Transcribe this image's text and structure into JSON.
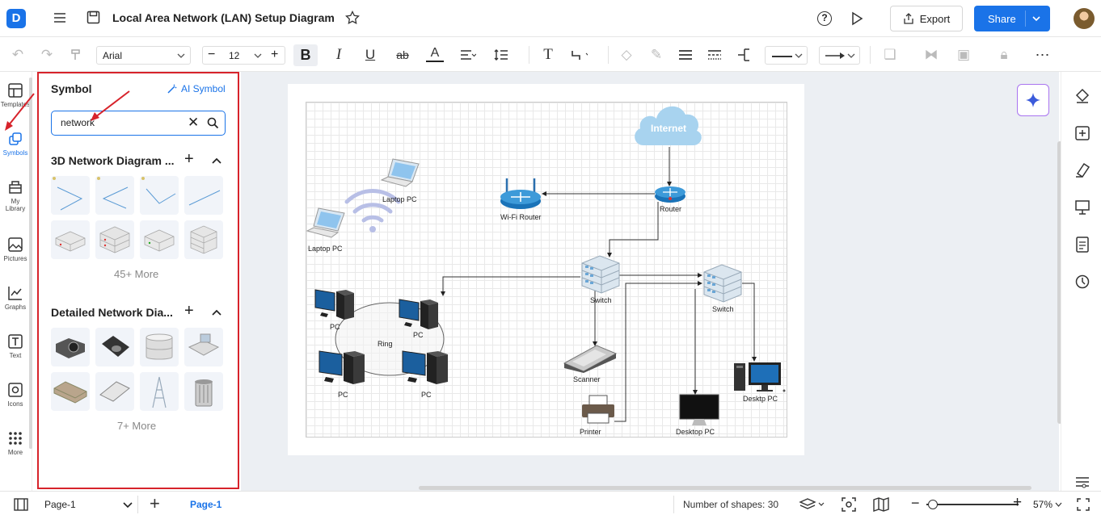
{
  "header": {
    "title": "Local Area Network (LAN) Setup Diagram",
    "export_label": "Export",
    "share_label": "Share"
  },
  "toolbar": {
    "font_family": "Arial",
    "font_size": "12"
  },
  "left_rail": {
    "items": [
      {
        "label": "Templates",
        "icon": "templates-icon"
      },
      {
        "label": "Symbols",
        "icon": "symbols-icon"
      },
      {
        "label": "My Library",
        "icon": "library-icon"
      },
      {
        "label": "Pictures",
        "icon": "pictures-icon"
      },
      {
        "label": "Graphs",
        "icon": "graphs-icon"
      },
      {
        "label": "Text",
        "icon": "text-icon"
      },
      {
        "label": "Icons",
        "icon": "icons-icon"
      },
      {
        "label": "More",
        "icon": "grid-icon"
      }
    ]
  },
  "symbol_panel": {
    "title": "Symbol",
    "ai_label": "AI Symbol",
    "search_value": "network",
    "sections": [
      {
        "title": "3D Network Diagram ...",
        "more": "45+ More"
      },
      {
        "title": "Detailed Network Dia...",
        "more": "7+ More"
      }
    ]
  },
  "diagram": {
    "labels": {
      "internet": "Internet",
      "router": "Router",
      "wifi_router": "Wi-Fi Router",
      "laptop1": "Laptop PC",
      "laptop2": "Laptop PC",
      "switch1": "Switch",
      "switch2": "Switch",
      "ring": "Ring",
      "pc1": "PC",
      "pc2": "PC",
      "pc3": "PC",
      "pc4": "PC",
      "scanner": "Scanner",
      "printer": "Printer",
      "desktop": "Desktop PC",
      "desktp": "Desktp PC"
    }
  },
  "status": {
    "page_select": "Page-1",
    "page_tab": "Page-1",
    "shapes": "Number of shapes: 30",
    "zoom": "57%"
  },
  "colors": {
    "accent": "#1a73e8",
    "highlight": "#d7232b",
    "cloud": "#a8d3ef"
  }
}
